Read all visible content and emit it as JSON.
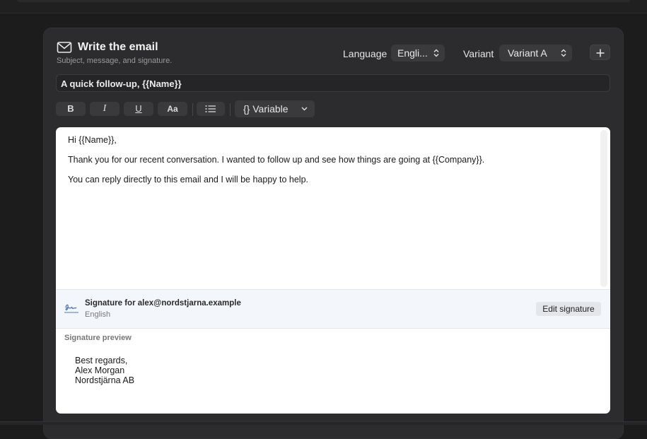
{
  "header": {
    "title": "Write the email",
    "subtitle": "Subject, message, and signature.",
    "icon": "envelope-icon"
  },
  "controls": {
    "language_label": "Language",
    "language_value": "Engli...",
    "variant_label": "Variant",
    "variant_value": "Variant A",
    "add_icon": "plus-icon"
  },
  "subject": {
    "value": "A quick follow-up, {{Name}}"
  },
  "toolbar": {
    "bold": "B",
    "italic": "I",
    "underline": "U",
    "text_size": "Aa",
    "list_icon": "bulleted-list-icon",
    "variable_label": "{} Variable"
  },
  "editor": {
    "lines": [
      "Hi {{Name}},",
      "Thank you for our recent conversation. I wanted to follow up and see how things are going at {{Company}}.",
      "You can reply directly to this email and I will be happy to help."
    ]
  },
  "signature": {
    "icon": "signature-icon",
    "title": "Signature for alex@nordstjarna.example",
    "language": "English",
    "edit_label": "Edit signature",
    "preview_label": "Signature preview",
    "preview_lines": [
      "Best regards,",
      "Alex Morgan",
      "Nordstjärna AB"
    ]
  },
  "colors": {
    "background": "#1c1c1d",
    "card": "#2c2c2e",
    "control": "#3a3a3d",
    "signature_accent": "#4a78c8"
  }
}
